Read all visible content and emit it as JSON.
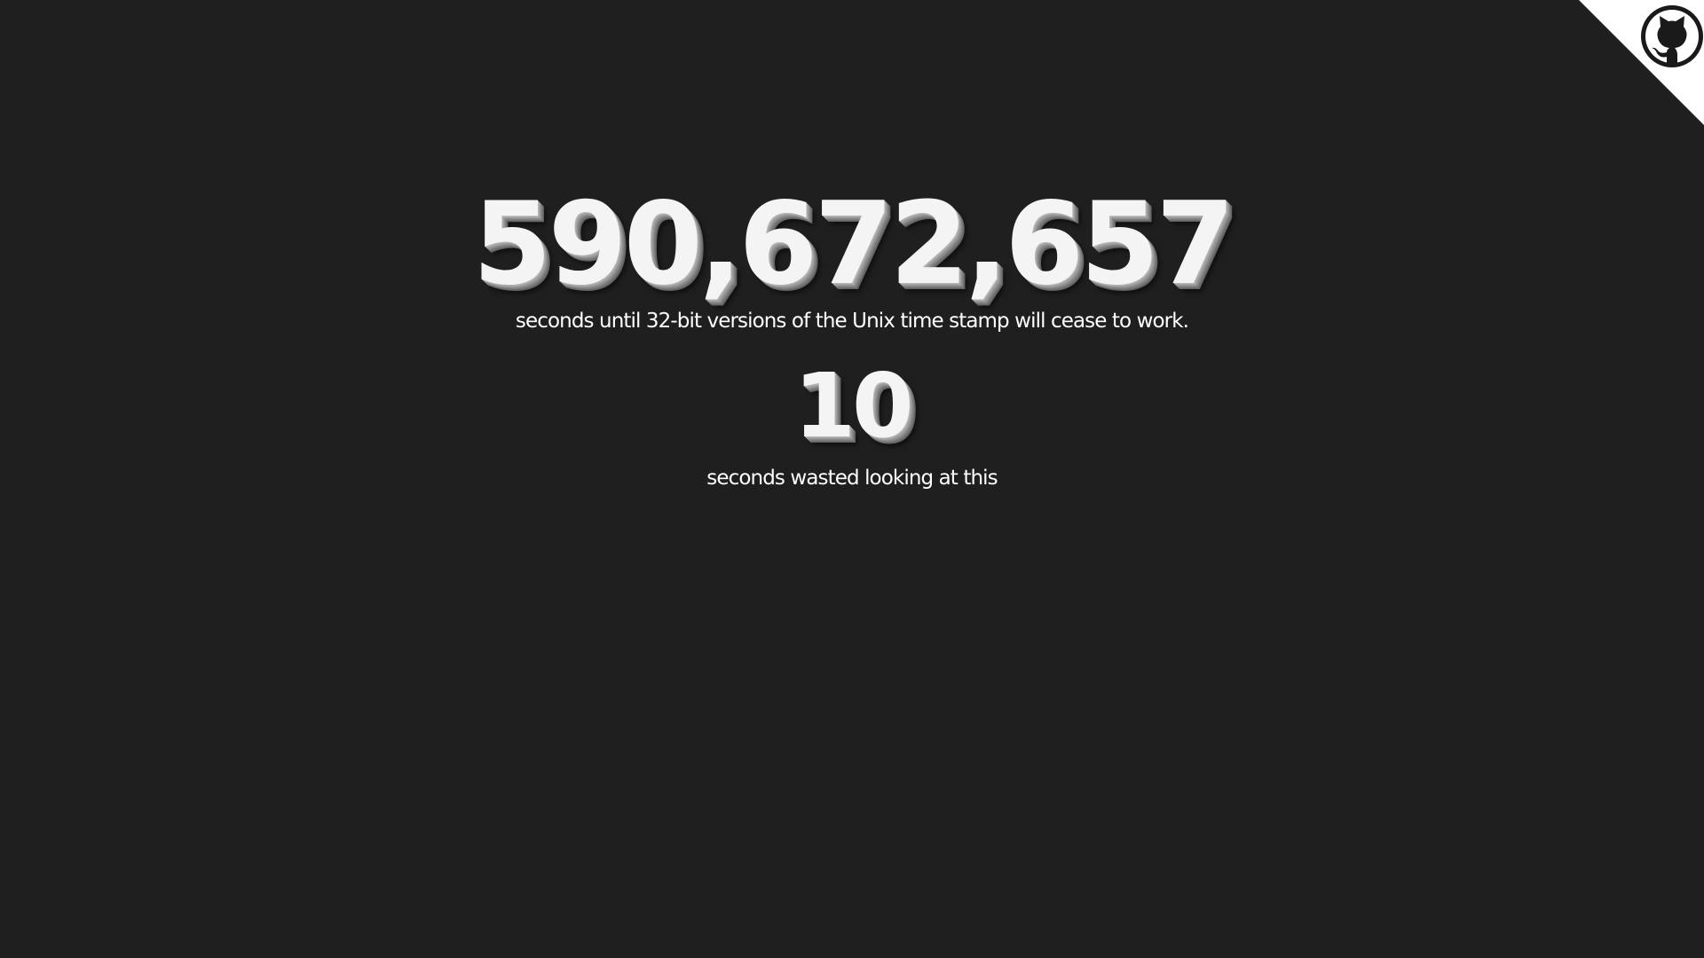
{
  "colors": {
    "background": "#1f1f1f",
    "number_fill": "#f4f4f4",
    "number_shadow": "#8a8a8a",
    "caption": "#ffffff",
    "corner_fill": "#ffffff",
    "icon_fill": "#1a1a1a"
  },
  "corner": {
    "icon": "github-octocat-icon"
  },
  "unix_countdown": {
    "value": "590,672,657",
    "caption": "seconds until 32-bit versions of the Unix time stamp will cease to work."
  },
  "wasted_counter": {
    "value": "10",
    "caption": "seconds wasted looking at this"
  }
}
